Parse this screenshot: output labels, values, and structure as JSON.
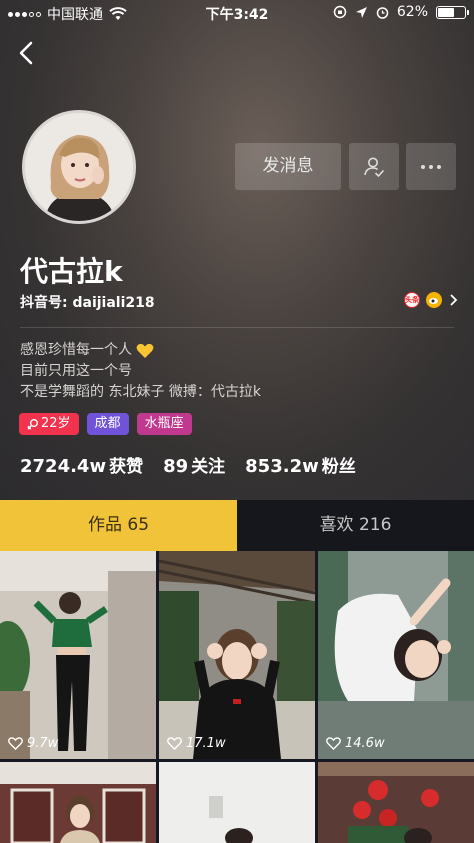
{
  "statusbar": {
    "carrier": "中国联通",
    "time": "下午3:42",
    "battery": "62%",
    "battery_level": 0.62
  },
  "profile": {
    "nickname": "代古拉k",
    "id_label": "抖音号:",
    "id_value": "daijiali218",
    "send_message": "发消息",
    "linked_apps": {
      "toutiao": "头条"
    },
    "bio": [
      "感恩珍惜每一个人",
      "目前只用这一个号",
      "不是学舞蹈的 东北妹子 微搏：代古拉k"
    ],
    "tags": {
      "age": "22岁",
      "city": "成都",
      "zodiac": "水瓶座"
    },
    "stats": [
      {
        "value": "2724.4w",
        "label": "获赞"
      },
      {
        "value": "89",
        "label": "关注"
      },
      {
        "value": "853.2w",
        "label": "粉丝"
      }
    ]
  },
  "tabs": [
    {
      "label": "作品 65",
      "active": true
    },
    {
      "label": "喜欢 216",
      "active": false
    }
  ],
  "videos": [
    {
      "likes": "9.7w"
    },
    {
      "likes": "17.1w"
    },
    {
      "likes": "14.6w"
    },
    {
      "likes": ""
    },
    {
      "likes": ""
    },
    {
      "likes": ""
    }
  ],
  "colors": {
    "active_tab": "#f0c338",
    "tag_age": "#f1334d",
    "tag_city": "#7053d8",
    "tag_zodiac": "#c1398e"
  }
}
